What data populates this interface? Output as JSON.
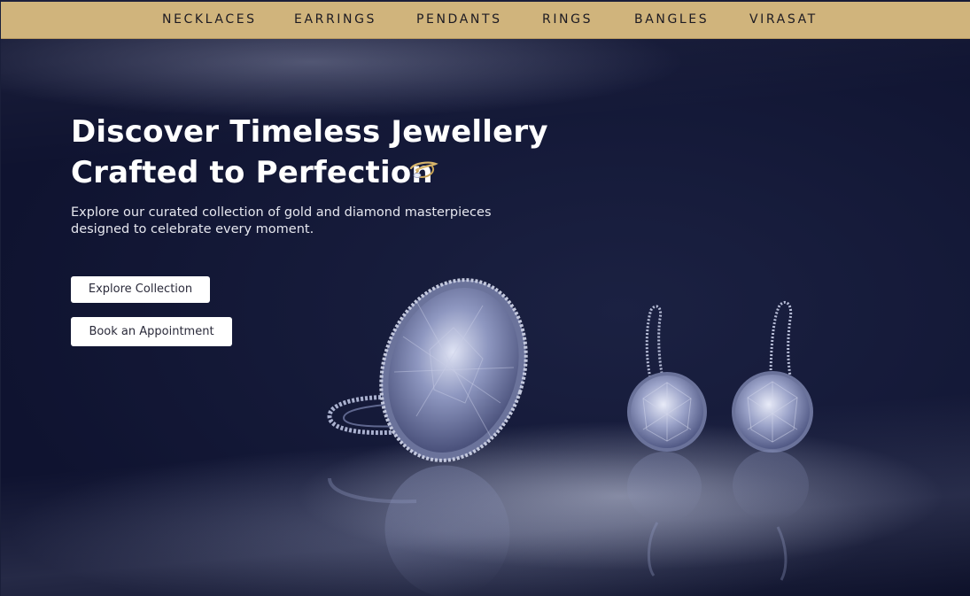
{
  "nav": {
    "items": [
      "NECKLACES",
      "EARRINGS",
      "PENDANTS",
      "RINGS",
      "BANGLES",
      "VIRASAT"
    ]
  },
  "hero": {
    "headline_line1": "Discover Timeless Jewellery",
    "headline_line2": "Crafted to Perfection",
    "subtext_line1": "Explore our curated collection of gold and diamond masterpieces",
    "subtext_line2": "designed to celebrate every moment.",
    "primary_button": "Explore Collection",
    "secondary_button": "Book an Appointment"
  },
  "colors": {
    "nav_background": "#d0b47c",
    "hero_background": "#14183a",
    "text_light": "#ffffff",
    "button_background": "#ffffff"
  },
  "icons": {
    "headline_icon": "gold-ring-icon"
  }
}
